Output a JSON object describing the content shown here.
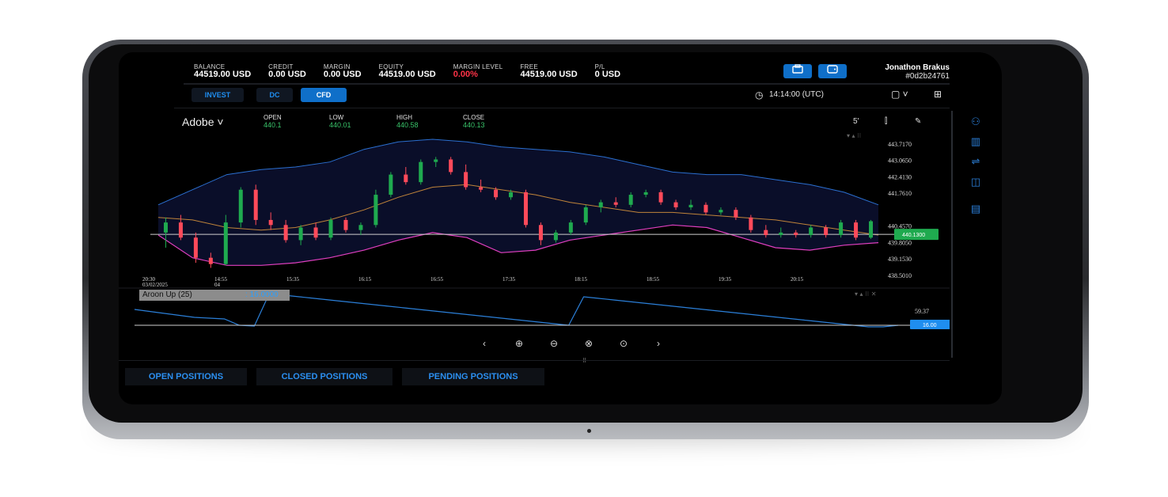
{
  "header": {
    "stats": [
      {
        "label": "BALANCE",
        "value": "44519.00 USD"
      },
      {
        "label": "CREDIT",
        "value": "0.00 USD"
      },
      {
        "label": "MARGIN",
        "value": "0.00 USD"
      },
      {
        "label": "EQUITY",
        "value": "44519.00 USD"
      },
      {
        "label": "MARGIN LEVEL",
        "value": "0.00%",
        "color": "#ff3347"
      },
      {
        "label": "FREE",
        "value": "44519.00 USD"
      },
      {
        "label": "P/L",
        "value": "0 USD"
      }
    ],
    "user_name": "Jonathon Brakus",
    "user_id": "#0d2b24761"
  },
  "modes": [
    "INVEST",
    "DC",
    "CFD"
  ],
  "active_mode": "CFD",
  "clock": "14:14:00 (UTC)",
  "chart_header": {
    "symbol": "Adobe",
    "open_label": "OPEN",
    "open": "440.1",
    "low_label": "LOW",
    "low": "440.01",
    "high_label": "HIGH",
    "high": "440.58",
    "close_label": "CLOSE",
    "close": "440.13",
    "interval": "5'"
  },
  "indicator": {
    "label": "Aroon Up (25)",
    "value": ": 16.0000",
    "last": "16.00"
  },
  "price_tag": "440.1300",
  "position_tabs": [
    "OPEN POSITIONS",
    "CLOSED POSITIONS",
    "PENDING POSITIONS"
  ],
  "icons": {
    "accent": "#0f6fc9",
    "up_color": "#1faa4f",
    "down_color": "#ff4a5a",
    "upper_band": "#2b6fd0",
    "middle_band": "#c0843a",
    "lower_band": "#e03fbf"
  },
  "chart_data": {
    "type": "line",
    "x_ticks": [
      "20:30\n03/02/2025",
      "14:55\n04",
      "15:35",
      "16:15",
      "16:55",
      "17:35",
      "18:15",
      "18:55",
      "19:35",
      "20:15"
    ],
    "y_ticks": [
      "443.7170",
      "443.0650",
      "442.4130",
      "441.7610",
      "440.4570",
      "439.8050",
      "439.1530",
      "438.5010"
    ],
    "ylim": [
      438.5,
      443.9
    ],
    "candles": [
      [
        440.2,
        440.8,
        439.6,
        440.6
      ],
      [
        440.6,
        440.9,
        439.9,
        440.0
      ],
      [
        440.0,
        440.2,
        439.0,
        439.2
      ],
      [
        439.2,
        439.4,
        438.8,
        438.95
      ],
      [
        438.95,
        440.9,
        438.9,
        440.6
      ],
      [
        440.6,
        442.0,
        440.4,
        441.9
      ],
      [
        441.9,
        442.1,
        440.5,
        440.7
      ],
      [
        440.7,
        441.0,
        440.3,
        440.5
      ],
      [
        440.5,
        440.7,
        439.8,
        439.9
      ],
      [
        439.9,
        440.5,
        439.7,
        440.4
      ],
      [
        440.4,
        440.6,
        439.9,
        440.0
      ],
      [
        440.0,
        440.8,
        439.9,
        440.7
      ],
      [
        440.7,
        440.8,
        440.2,
        440.3
      ],
      [
        440.3,
        440.6,
        440.1,
        440.5
      ],
      [
        440.5,
        441.9,
        440.4,
        441.7
      ],
      [
        441.7,
        442.6,
        441.6,
        442.5
      ],
      [
        442.5,
        442.8,
        442.1,
        442.2
      ],
      [
        442.2,
        443.1,
        442.1,
        443.0
      ],
      [
        443.0,
        443.2,
        442.8,
        443.1
      ],
      [
        443.1,
        443.2,
        442.5,
        442.6
      ],
      [
        442.6,
        442.9,
        441.9,
        442.0
      ],
      [
        442.0,
        442.3,
        441.8,
        441.9
      ],
      [
        441.9,
        442.0,
        441.5,
        441.6
      ],
      [
        441.6,
        441.9,
        441.5,
        441.8
      ],
      [
        441.8,
        441.9,
        440.4,
        440.5
      ],
      [
        440.5,
        440.6,
        439.7,
        439.9
      ],
      [
        439.9,
        440.3,
        439.8,
        440.2
      ],
      [
        440.2,
        440.7,
        440.1,
        440.6
      ],
      [
        440.6,
        441.3,
        440.5,
        441.2
      ],
      [
        441.2,
        441.5,
        441.0,
        441.4
      ],
      [
        441.4,
        441.6,
        441.2,
        441.3
      ],
      [
        441.3,
        441.8,
        441.2,
        441.7
      ],
      [
        441.7,
        441.9,
        441.6,
        441.8
      ],
      [
        441.8,
        441.9,
        441.3,
        441.4
      ],
      [
        441.4,
        441.5,
        441.1,
        441.2
      ],
      [
        441.2,
        441.5,
        441.1,
        441.3
      ],
      [
        441.3,
        441.4,
        440.9,
        441.0
      ],
      [
        441.0,
        441.2,
        440.9,
        441.1
      ],
      [
        441.1,
        441.2,
        440.7,
        440.8
      ],
      [
        440.8,
        440.9,
        440.2,
        440.3
      ],
      [
        440.3,
        440.5,
        440.0,
        440.1
      ],
      [
        440.1,
        440.4,
        440.0,
        440.2
      ],
      [
        440.2,
        440.3,
        440.0,
        440.1
      ],
      [
        440.1,
        440.5,
        440.0,
        440.4
      ],
      [
        440.4,
        440.5,
        440.0,
        440.1
      ],
      [
        440.1,
        440.7,
        440.0,
        440.6
      ],
      [
        440.6,
        440.7,
        439.9,
        440.0
      ],
      [
        440.0,
        440.7,
        439.95,
        440.65
      ]
    ],
    "upper_band": [
      441.3,
      441.9,
      442.5,
      442.7,
      442.8,
      443.0,
      443.5,
      443.8,
      443.9,
      443.8,
      443.6,
      443.5,
      443.4,
      443.2,
      442.9,
      442.6,
      442.5,
      442.5,
      442.3,
      442.1,
      441.8,
      441.3
    ],
    "middle_band": [
      440.8,
      440.7,
      440.4,
      440.3,
      440.4,
      440.7,
      441.1,
      441.6,
      442.0,
      442.1,
      441.9,
      441.7,
      441.4,
      441.2,
      441.0,
      441.0,
      440.9,
      440.8,
      440.7,
      440.5,
      440.3,
      440.1
    ],
    "lower_band": [
      440.1,
      439.2,
      438.9,
      438.9,
      439.0,
      439.2,
      439.5,
      439.9,
      440.2,
      440.0,
      439.4,
      439.5,
      439.9,
      440.1,
      440.3,
      440.5,
      440.4,
      440.0,
      439.6,
      439.5,
      439.7,
      439.8
    ],
    "aroon_up": [
      60,
      55,
      50,
      45,
      40,
      38,
      36,
      20,
      18,
      100,
      96,
      92,
      88,
      84,
      80,
      76,
      72,
      68,
      64,
      60,
      56,
      52,
      48,
      44,
      40,
      36,
      32,
      28,
      24,
      20,
      92,
      88,
      84,
      80,
      76,
      72,
      68,
      64,
      60,
      56,
      52,
      48,
      44,
      40,
      36,
      32,
      28,
      24,
      20,
      16,
      16,
      20
    ],
    "aroon_level": 50,
    "aroon_ticks": [
      "59.37"
    ]
  }
}
